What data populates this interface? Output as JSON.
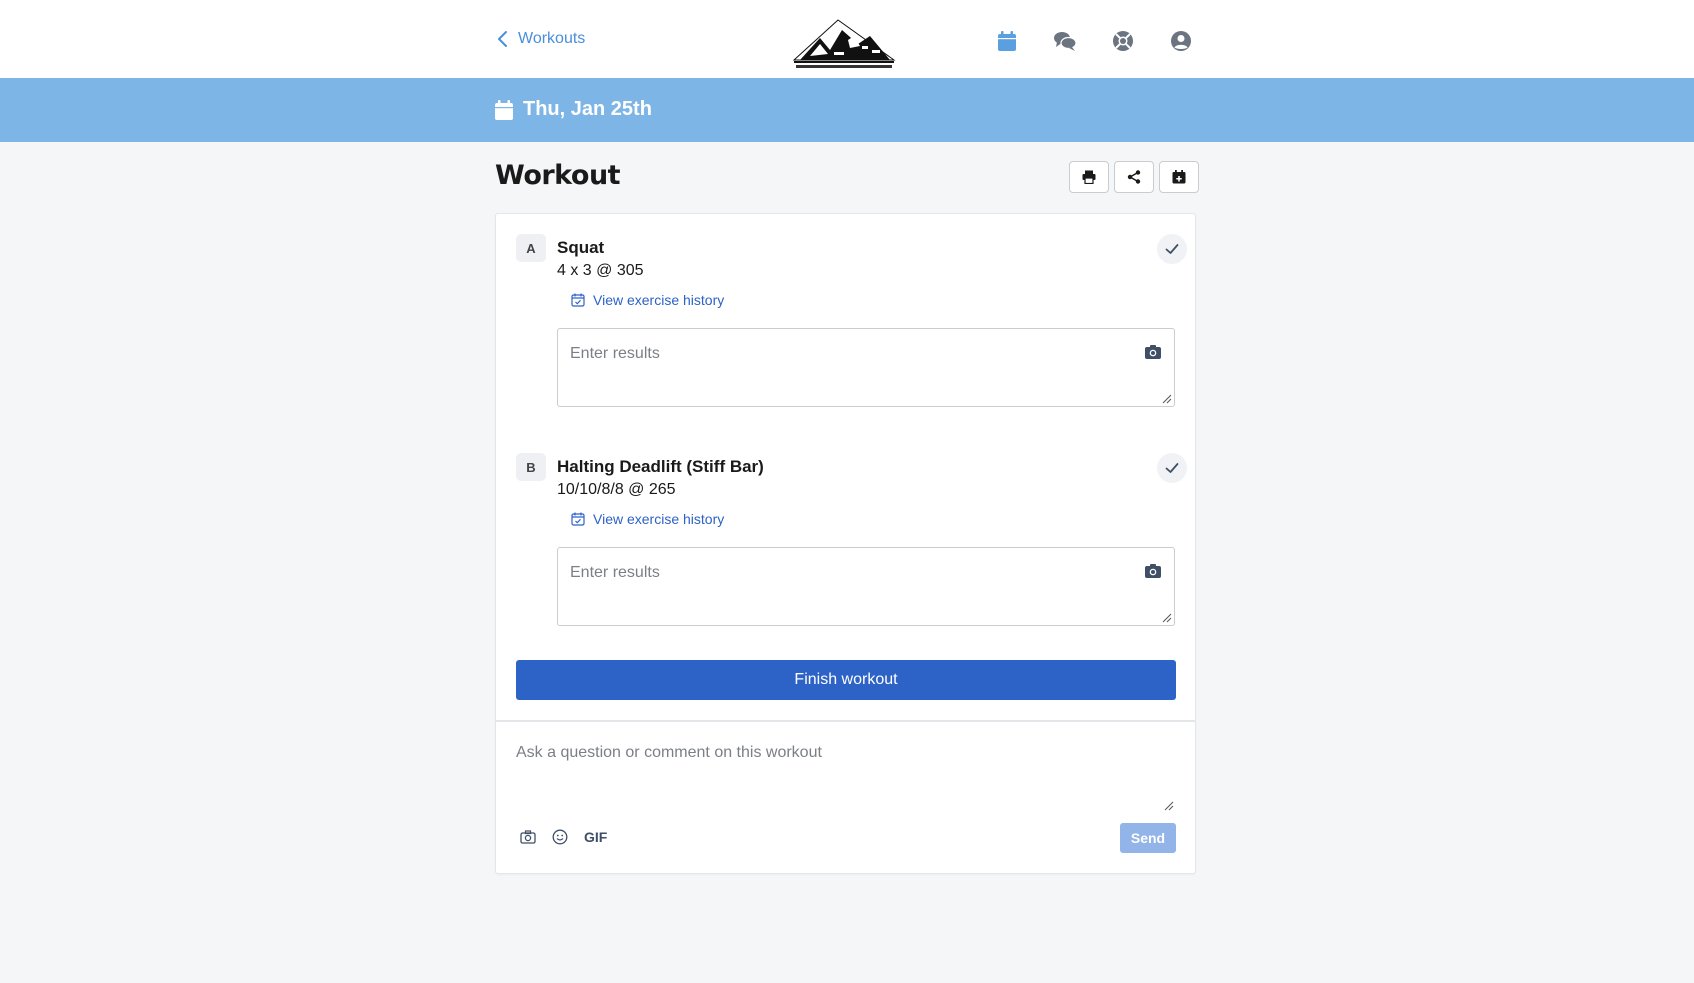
{
  "header": {
    "back_label": "Workouts",
    "logo_alt": "Morris Strength & Rehab logo",
    "nav_icons": [
      "calendar-icon",
      "chat-icon",
      "help-icon",
      "user-icon"
    ]
  },
  "date_bar": {
    "date": "Thu, Jan 25th"
  },
  "page": {
    "title": "Workout",
    "actions": [
      "print-icon",
      "share-icon",
      "calendar-add-icon"
    ]
  },
  "exercises": [
    {
      "letter": "A",
      "name": "Squat",
      "detail": "4 x 3 @ 305",
      "history_label": "View exercise history",
      "results_placeholder": "Enter results"
    },
    {
      "letter": "B",
      "name": "Halting Deadlift (Stiff Bar)",
      "detail": "10/10/8/8 @ 265",
      "history_label": "View exercise history",
      "results_placeholder": "Enter results"
    }
  ],
  "finish_label": "Finish workout",
  "comment": {
    "placeholder": "Ask a question or comment on this workout",
    "gif_label": "GIF",
    "send_label": "Send"
  },
  "colors": {
    "accent": "#2d62c7",
    "date_bar": "#7db5e6",
    "link": "#4a8fd9",
    "send_disabled": "#92b4e8"
  }
}
